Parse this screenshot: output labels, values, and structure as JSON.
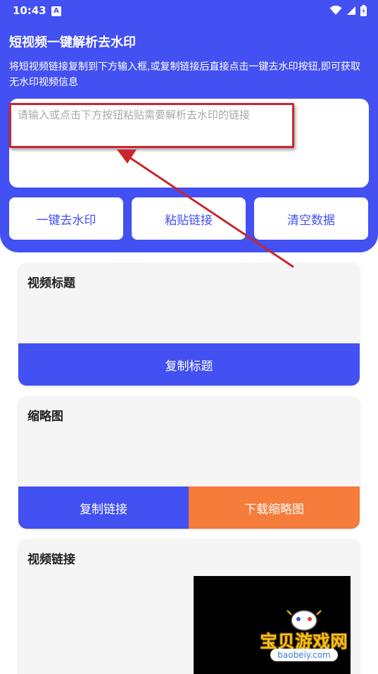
{
  "status_bar": {
    "time": "10:43",
    "notification_icon": "A"
  },
  "header": {
    "title": "短视频一键解析去水印",
    "description": "将短视频链接复制到下方输入框,或复制链接后直接点击一键去水印按钮,即可获取无水印视频信息",
    "input_placeholder": "请输入或点击下方按钮粘贴需要解析去水印的链接",
    "input_value": "",
    "buttons": {
      "remove_watermark": "一键去水印",
      "paste_link": "粘贴链接",
      "clear_data": "清空数据"
    }
  },
  "cards": {
    "video_title": {
      "label": "视频标题",
      "copy_button": "复制标题"
    },
    "thumbnail": {
      "label": "缩略图",
      "copy_button": "复制链接",
      "download_button": "下载缩略图"
    },
    "video_link": {
      "label": "视频链接"
    }
  },
  "watermark": {
    "site_name": "宝贝游戏网",
    "site_url": "baobeiy.com"
  },
  "colors": {
    "primary": "#4350f2",
    "accent_orange": "#f57c3b",
    "annotation_red": "#c8262c"
  }
}
